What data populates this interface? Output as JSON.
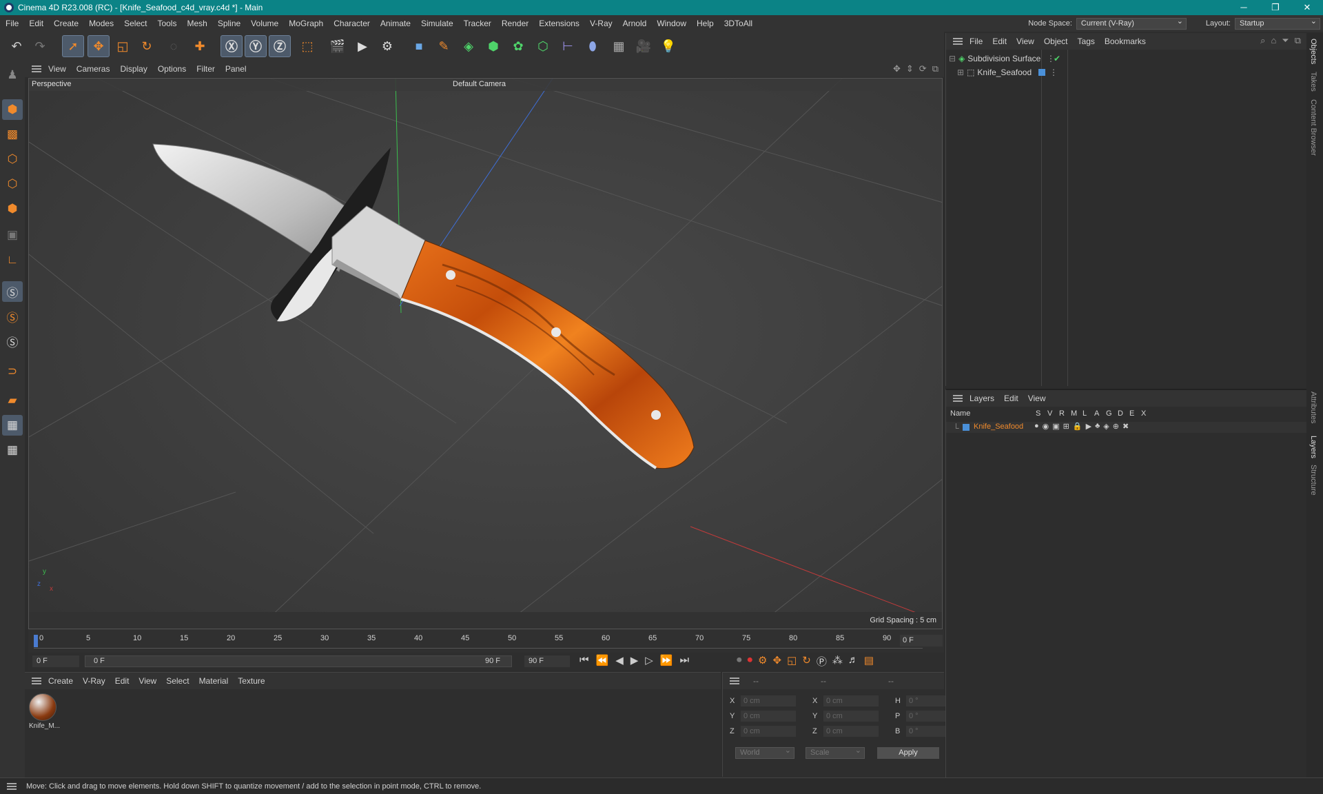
{
  "titlebar": {
    "title": "Cinema 4D R23.008 (RC) - [Knife_Seafood_c4d_vray.c4d *] - Main",
    "minimize": "─",
    "restore": "❐",
    "close": "✕"
  },
  "menubar": {
    "items": [
      "File",
      "Edit",
      "Create",
      "Modes",
      "Select",
      "Tools",
      "Mesh",
      "Spline",
      "Volume",
      "MoGraph",
      "Character",
      "Animate",
      "Simulate",
      "Tracker",
      "Render",
      "Extensions",
      "V-Ray",
      "Arnold",
      "Window",
      "Help",
      "3DToAll"
    ],
    "node_space_label": "Node Space:",
    "node_space_value": "Current (V-Ray)",
    "layout_label": "Layout:",
    "layout_value": "Startup"
  },
  "viewport": {
    "menu": [
      "View",
      "Cameras",
      "Display",
      "Options",
      "Filter",
      "Panel"
    ],
    "view_name": "Perspective",
    "camera_name": "Default Camera",
    "grid_spacing": "Grid Spacing : 5 cm",
    "axis_y": "y",
    "axis_z": "z",
    "axis_x": "x"
  },
  "timeline": {
    "ticks": [
      "0",
      "5",
      "10",
      "15",
      "20",
      "25",
      "30",
      "35",
      "40",
      "45",
      "50",
      "55",
      "60",
      "65",
      "70",
      "75",
      "80",
      "85",
      "90"
    ],
    "current_frame": "0 F"
  },
  "transport": {
    "start": "0 F",
    "range_start": "0 F",
    "range_end": "90 F",
    "end": "90 F"
  },
  "material_panel": {
    "menu": [
      "Create",
      "V-Ray",
      "Edit",
      "View",
      "Select",
      "Material",
      "Texture"
    ],
    "material_name": "Knife_M..."
  },
  "coords": {
    "headers": [
      "--",
      "--",
      "--"
    ],
    "rows": [
      {
        "a": "X",
        "av": "0 cm",
        "b": "X",
        "bv": "0 cm",
        "c": "H",
        "cv": "0 °"
      },
      {
        "a": "Y",
        "av": "0 cm",
        "b": "Y",
        "bv": "0 cm",
        "c": "P",
        "cv": "0 °"
      },
      {
        "a": "Z",
        "av": "0 cm",
        "b": "Z",
        "bv": "0 cm",
        "c": "B",
        "cv": "0 °"
      }
    ],
    "space": "World",
    "mode": "Scale",
    "apply": "Apply"
  },
  "objects": {
    "menu": [
      "File",
      "Edit",
      "View",
      "Object",
      "Tags",
      "Bookmarks"
    ],
    "items": [
      {
        "name": "Subdivision Surface"
      },
      {
        "name": "Knife_Seafood"
      }
    ]
  },
  "layers": {
    "menu": [
      "Layers",
      "Edit",
      "View"
    ],
    "columns": [
      "Name",
      "S",
      "V",
      "R",
      "M",
      "L",
      "A",
      "G",
      "D",
      "E",
      "X"
    ],
    "rows": [
      {
        "name": "Knife_Seafood"
      }
    ]
  },
  "right_tabs": [
    "Objects",
    "Takes",
    "Content Browser",
    "Attributes",
    "Layers",
    "Structure"
  ],
  "status": "Move: Click and drag to move elements. Hold down SHIFT to quantize movement / add to the selection in point mode, CTRL to remove.",
  "colors": {
    "titlebar": "#0b8386",
    "accent_orange": "#f08a2c",
    "layer_blue": "#4a90d9"
  }
}
